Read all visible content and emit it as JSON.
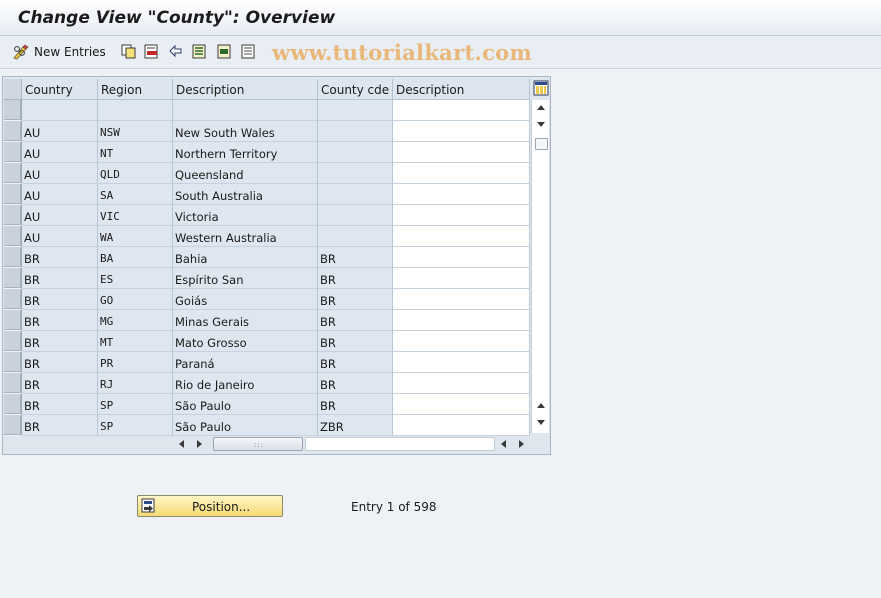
{
  "title": "Change View \"County\": Overview",
  "toolbar": {
    "new_entries_label": "New Entries",
    "watermark": "www.tutorialkart.com",
    "icons": [
      "pencil-glasses-icon",
      "copy-icon",
      "delete-icon",
      "undo-icon",
      "select-all-icon",
      "select-block-icon",
      "deselect-all-icon"
    ]
  },
  "table": {
    "columns": [
      "Country",
      "Region",
      "Description",
      "County cde",
      "Description"
    ],
    "rows": [
      {
        "country": "",
        "region": "",
        "description": "",
        "county_cde": "",
        "description2": ""
      },
      {
        "country": "AU",
        "region": "NSW",
        "description": "New South Wales",
        "county_cde": "",
        "description2": ""
      },
      {
        "country": "AU",
        "region": "NT",
        "description": "Northern Territory",
        "county_cde": "",
        "description2": ""
      },
      {
        "country": "AU",
        "region": "QLD",
        "description": "Queensland",
        "county_cde": "",
        "description2": ""
      },
      {
        "country": "AU",
        "region": "SA",
        "description": "South Australia",
        "county_cde": "",
        "description2": ""
      },
      {
        "country": "AU",
        "region": "VIC",
        "description": "Victoria",
        "county_cde": "",
        "description2": ""
      },
      {
        "country": "AU",
        "region": "WA",
        "description": "Western Australia",
        "county_cde": "",
        "description2": ""
      },
      {
        "country": "BR",
        "region": "BA",
        "description": "Bahia",
        "county_cde": "BR",
        "description2": ""
      },
      {
        "country": "BR",
        "region": "ES",
        "description": "Espírito San",
        "county_cde": "BR",
        "description2": ""
      },
      {
        "country": "BR",
        "region": "GO",
        "description": "Goiás",
        "county_cde": "BR",
        "description2": ""
      },
      {
        "country": "BR",
        "region": "MG",
        "description": "Minas Gerais",
        "county_cde": "BR",
        "description2": ""
      },
      {
        "country": "BR",
        "region": "MT",
        "description": "Mato Grosso",
        "county_cde": "BR",
        "description2": ""
      },
      {
        "country": "BR",
        "region": "PR",
        "description": "Paraná",
        "county_cde": "BR",
        "description2": ""
      },
      {
        "country": "BR",
        "region": "RJ",
        "description": "Rio de Janeiro",
        "county_cde": "BR",
        "description2": ""
      },
      {
        "country": "BR",
        "region": "SP",
        "description": "São Paulo",
        "county_cde": "BR",
        "description2": ""
      },
      {
        "country": "BR",
        "region": "SP",
        "description": "São Paulo",
        "county_cde": "ZBR",
        "description2": ""
      }
    ]
  },
  "footer": {
    "position_button": "Position...",
    "entry_text": "Entry 1 of 598"
  },
  "colors": {
    "background": "#eef2f7",
    "readonly_cell": "#dee7f0",
    "button_yellow": "#f5da73",
    "watermark": "#e9b878"
  }
}
